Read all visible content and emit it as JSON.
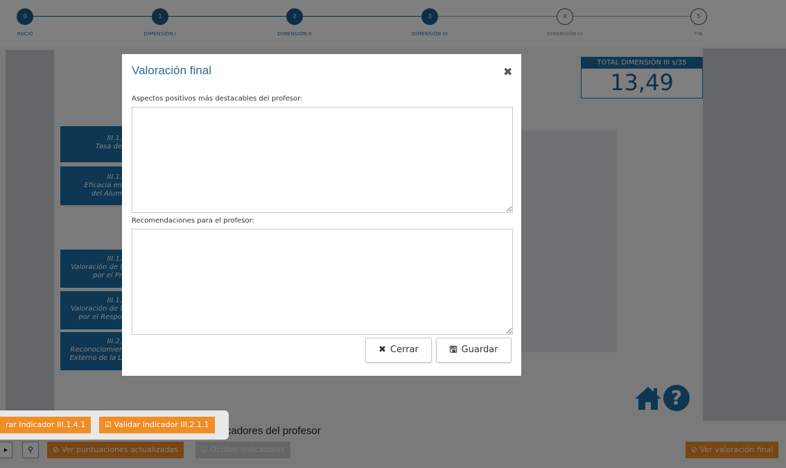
{
  "stepper": {
    "steps": [
      {
        "num": "0",
        "label": "INICIO"
      },
      {
        "num": "1",
        "label": "DIMENSIÓN I"
      },
      {
        "num": "2",
        "label": "DIMENSIÓN II"
      },
      {
        "num": "3",
        "label": "DIMENSIÓN III"
      },
      {
        "num": "4",
        "label": "DIMENSIÓN IV"
      },
      {
        "num": "5",
        "label": "FIN"
      }
    ],
    "current_step": 3
  },
  "total": {
    "label": "TOTAL DIMENSIÓN III s/35",
    "value": "13,49"
  },
  "indicators": [
    {
      "code": "III.1.",
      "name": "Tasa de"
    },
    {
      "code": "III.1.",
      "name": "Eficacia en",
      "name2": "del Alum"
    },
    {
      "code": "III.1.",
      "name": "Valoración de l",
      "name2": "por el Pr"
    },
    {
      "code": "III.1.",
      "name": "Valoración de l",
      "name2": "por el Respo"
    },
    {
      "code": "III.2.",
      "name": "Reconociomier",
      "name2": "Externo de la L"
    }
  ],
  "section_title": "cadores del profesor",
  "buttons": {
    "validar_1": "rar Indicador III.1.4.1",
    "validar_2": "Validar Indicador III.2.1.1",
    "ver_puntuaciones": "Ver puntuaciones actualizadas",
    "ocultar": "Ocultar Indicadores",
    "ver_valoracion": "Ver valoración final"
  },
  "modal": {
    "title": "Valoración final",
    "close_glyph": "✖",
    "label_positivos": "Aspectos positivos más destacables del profesor:",
    "value_positivos": "",
    "label_recomendaciones": "Recomendaciones para el profesor:",
    "value_recomendaciones": "",
    "cerrar_label": "Cerrar",
    "guardar_label": "Guardar"
  },
  "colors": {
    "primary": "#1f6fa5",
    "orange": "#ef8d26",
    "disabled": "#c9cdd1"
  }
}
